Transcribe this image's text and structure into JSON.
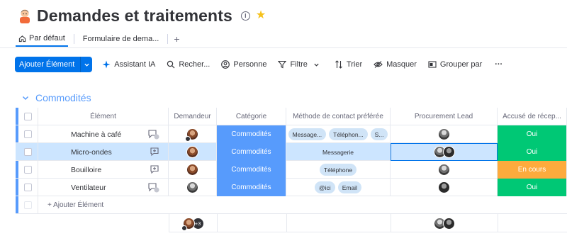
{
  "header": {
    "title": "Demandes et traitements",
    "info_icon": "info-icon",
    "star_icon": "star-icon"
  },
  "tabs": [
    {
      "label": "Par défaut",
      "icon": "home-icon",
      "active": true
    },
    {
      "label": "Formulaire de dema...",
      "active": false
    }
  ],
  "tabs_add": "+",
  "toolbar": {
    "add_item": "Ajouter Élément",
    "ai": "Assistant IA",
    "search": "Recher...",
    "person": "Personne",
    "filter": "Filtre",
    "sort": "Trier",
    "hide": "Masquer",
    "group_by": "Grouper par",
    "more": "···"
  },
  "group": {
    "title": "Commodités",
    "color": "#579bfc"
  },
  "columns": {
    "item": "Élément",
    "requester": "Demandeur",
    "category": "Catégorie",
    "contact": "Méthode de contact préférée",
    "lead": "Procurement Lead",
    "ack": "Accusé de récep..."
  },
  "rows": [
    {
      "name": "Machine à café",
      "updates": "1",
      "category": "Commodités",
      "contact": [
        "Message...",
        "Téléphon...",
        "S..."
      ],
      "ack": "Oui"
    },
    {
      "name": "Micro-ondes",
      "updates": "",
      "category": "Commodités",
      "contact": [
        "Messagerie"
      ],
      "ack": "Oui"
    },
    {
      "name": "Bouilloire",
      "updates": "",
      "category": "Commodités",
      "contact": [
        "Téléphone"
      ],
      "ack": "En cours"
    },
    {
      "name": "Ventilateur",
      "updates": "2",
      "category": "Commodités",
      "contact": [
        "@ici",
        "Email"
      ],
      "ack": "Oui"
    }
  ],
  "add_item_row": "+ Ajouter Élément",
  "footer": {
    "requester_more": "+3"
  },
  "colors": {
    "primary": "#0073ea",
    "category": "#579bfc",
    "done": "#00c875",
    "working": "#fdab3d",
    "selected": "#cce5ff"
  }
}
